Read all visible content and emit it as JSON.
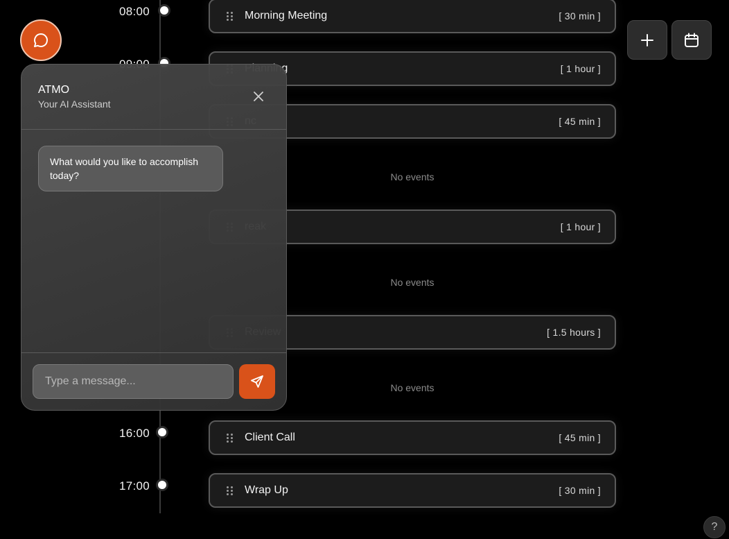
{
  "timeline": {
    "hours": [
      {
        "label": "08:00"
      },
      {
        "label": "09:00"
      },
      {
        "label": "16:00"
      },
      {
        "label": "17:00"
      }
    ]
  },
  "events": [
    {
      "title": "Morning Meeting",
      "duration": "[ 30 min ]"
    },
    {
      "title": "Planning",
      "duration": "[ 1 hour ]"
    },
    {
      "title": "nc",
      "duration": "[ 45 min ]"
    },
    {
      "title": "reak",
      "duration": "[ 1 hour ]"
    },
    {
      "title": "Review",
      "duration": "[ 1.5 hours ]"
    },
    {
      "title": "Client Call",
      "duration": "[ 45 min ]"
    },
    {
      "title": "Wrap Up",
      "duration": "[ 30 min ]"
    }
  ],
  "empty_slots": [
    "No events",
    "No events",
    "No events"
  ],
  "chat": {
    "title": "ATMO",
    "subtitle": "Your AI Assistant",
    "message": "What would you like to accomplish today?",
    "input_placeholder": "Type a message..."
  },
  "toolbar": {
    "add_icon": "plus-icon",
    "calendar_icon": "calendar-icon"
  },
  "help": {
    "label": "?"
  },
  "colors": {
    "accent": "#d9521a",
    "background": "#000000",
    "card_border": "#5a5a5a"
  }
}
